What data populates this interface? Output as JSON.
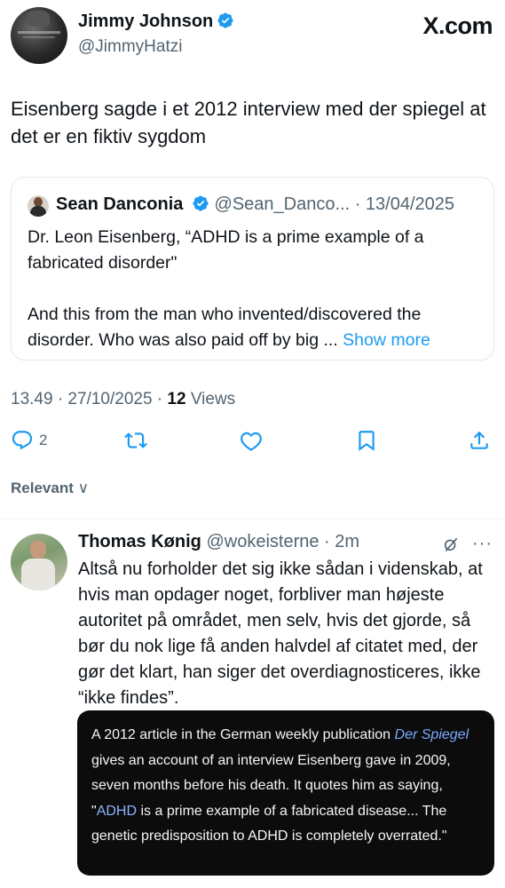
{
  "post": {
    "author_name": "Jimmy Johnson",
    "author_handle": "@JimmyHatzi",
    "site_label": "X.com",
    "text": "Eisenberg sagde i et 2012 interview med der spiegel at det er en fiktiv sygdom",
    "timestamp": "13.49 · 27/10/2025 · ",
    "views_count": "12",
    "views_label": " Views",
    "reply_count": "2",
    "icons": [
      "verified-badge-icon",
      "reply-icon",
      "repost-icon",
      "like-icon",
      "bookmark-icon",
      "share-icon"
    ]
  },
  "quote": {
    "author_name": "Sean Danconia",
    "meta": "@Sean_Danco... · 13/04/2025",
    "paragraph1": "Dr. Leon Eisenberg, “ADHD is a prime example of a fabricated disorder\"",
    "paragraph2": "And this from the man who invented/discovered the disorder. Who was also paid off by big ...",
    "show_more": "Show more"
  },
  "sort": {
    "label": "Relevant",
    "chevron": "∨"
  },
  "reply": {
    "author_name": "Thomas Kønig",
    "meta": "@wokeisterne · 2m",
    "more": "···",
    "text": "Altså nu forholder det sig ikke sådan i videnskab, at hvis man opdager noget, forbliver man højeste autoritet på området, men selv, hvis det gjorde, så bør du nok lige få anden halvdel af citatet med, der gør det klart, han siger det overdiagnosticeres, ikke “ikke findes”.",
    "image_text": {
      "part1": "A 2012 article in the German weekly publication ",
      "link1": "Der Spiegel",
      "part2": " gives an account of an interview Eisenberg gave in 2009, seven months before his death. It quotes him as saying, \"",
      "link2": "ADHD",
      "part3": " is a prime example of a fabricated disease... The genetic predisposition to ADHD is completely overrated.\""
    }
  },
  "colors": {
    "accent": "#1d9bf0",
    "secondary_text": "#536471",
    "text": "#0f1419"
  }
}
